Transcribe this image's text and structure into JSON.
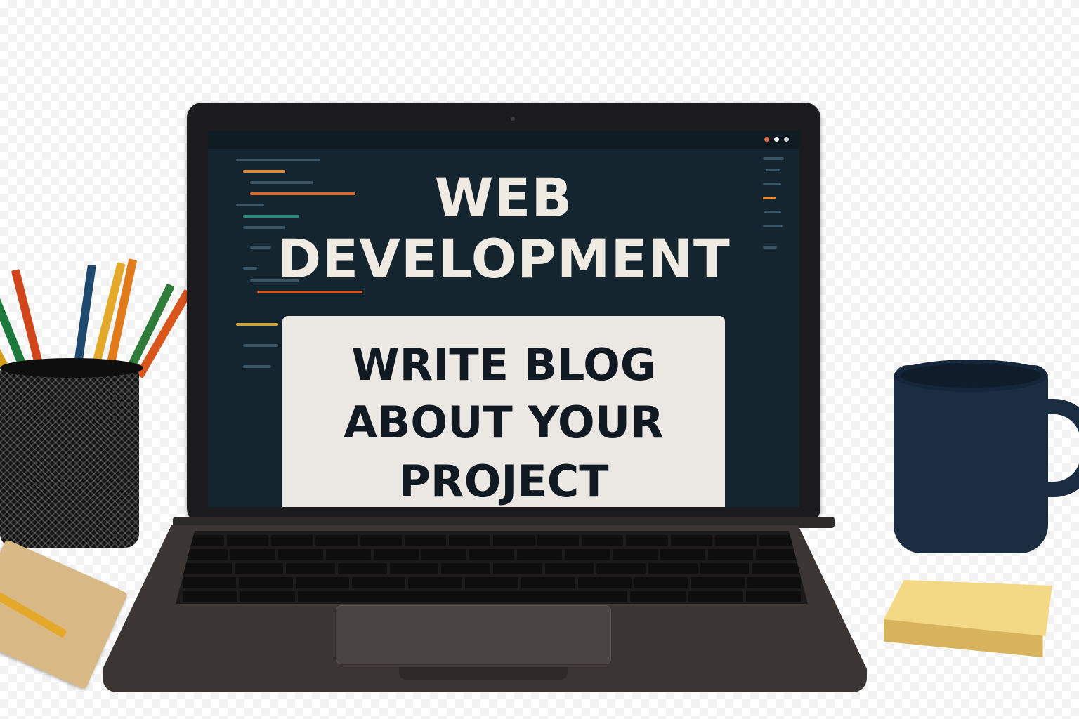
{
  "screen": {
    "title_line_1": "WEB",
    "title_line_2": "DEVELOPMENT",
    "blog_line_1": "WRITE BLOG",
    "blog_line_2": "ABOUT YOUR",
    "blog_line_3": "PROJECT"
  },
  "colors": {
    "screen_background": "#152530",
    "card_background": "#ebe8e3",
    "mug": "#1b2d41",
    "sticky_note": "#f3d986"
  },
  "icons": [
    "webcam-icon",
    "pencil-icon",
    "mug-icon"
  ]
}
